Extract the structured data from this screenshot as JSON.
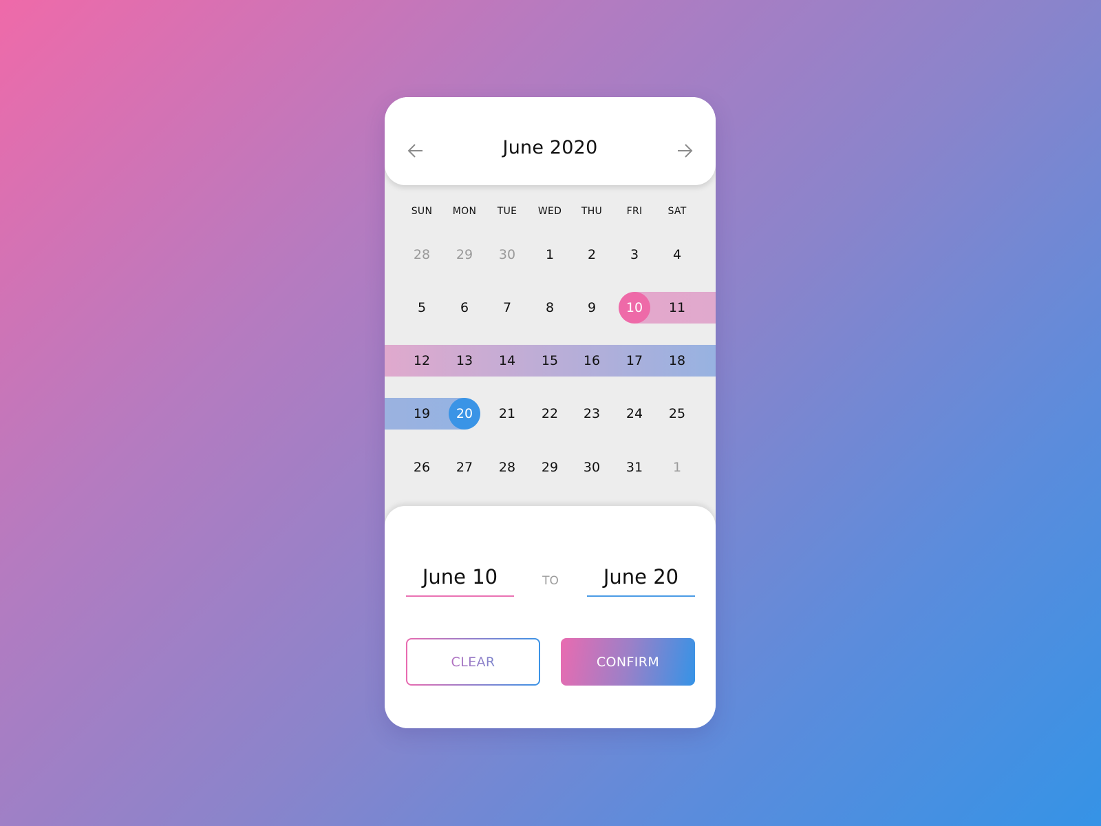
{
  "header": {
    "title": "June 2020",
    "prev_icon": "arrow-left-icon",
    "next_icon": "arrow-right-icon"
  },
  "weekdays": [
    "SUN",
    "MON",
    "TUE",
    "WED",
    "THU",
    "FRI",
    "SAT"
  ],
  "weeks": [
    [
      {
        "d": "28",
        "muted": true
      },
      {
        "d": "29",
        "muted": true
      },
      {
        "d": "30",
        "muted": true
      },
      {
        "d": "1"
      },
      {
        "d": "2"
      },
      {
        "d": "3"
      },
      {
        "d": "4"
      }
    ],
    [
      {
        "d": "5"
      },
      {
        "d": "6"
      },
      {
        "d": "7"
      },
      {
        "d": "8"
      },
      {
        "d": "9"
      },
      {
        "d": "10",
        "state": "start"
      },
      {
        "d": "11",
        "state": "in-range"
      }
    ],
    [
      {
        "d": "12",
        "state": "in-range"
      },
      {
        "d": "13",
        "state": "in-range"
      },
      {
        "d": "14",
        "state": "in-range"
      },
      {
        "d": "15",
        "state": "in-range"
      },
      {
        "d": "16",
        "state": "in-range"
      },
      {
        "d": "17",
        "state": "in-range"
      },
      {
        "d": "18",
        "state": "in-range"
      }
    ],
    [
      {
        "d": "19",
        "state": "in-range"
      },
      {
        "d": "20",
        "state": "end"
      },
      {
        "d": "21"
      },
      {
        "d": "22"
      },
      {
        "d": "23"
      },
      {
        "d": "24"
      },
      {
        "d": "25"
      }
    ],
    [
      {
        "d": "26"
      },
      {
        "d": "27"
      },
      {
        "d": "28"
      },
      {
        "d": "29"
      },
      {
        "d": "30"
      },
      {
        "d": "31"
      },
      {
        "d": "1",
        "muted": true
      }
    ]
  ],
  "range": {
    "from_label": "June 10",
    "separator": "TO",
    "to_label": "June 20"
  },
  "buttons": {
    "clear": "CLEAR",
    "confirm": "CONFIRM"
  },
  "colors": {
    "start": "#ee6aa8",
    "end": "#3a94e6",
    "range_start": "#e4a8cc",
    "range_end": "#93b3e2"
  }
}
